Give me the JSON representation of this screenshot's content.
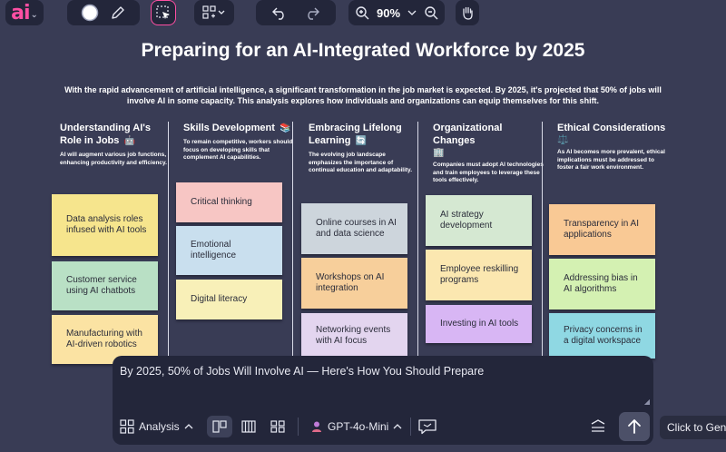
{
  "toolbar": {
    "logo": "ai",
    "zoom": "90%",
    "icons": [
      "color-circle-icon",
      "pencil-icon",
      "select-cursor-icon",
      "layout-grid-icon",
      "undo-icon",
      "redo-icon",
      "zoom-in-icon",
      "zoom-out-icon",
      "hand-icon"
    ]
  },
  "canvas": {
    "title": "Preparing for an AI-Integrated Workforce by 2025",
    "intro": "With the rapid advancement of artificial intelligence, a significant transformation in the job market is expected. By 2025, it's projected that 50% of jobs will involve AI in some capacity. This analysis explores how individuals and organizations can equip themselves for this shift.",
    "columns": [
      {
        "title": "Understanding AI's Role in Jobs",
        "emoji": "🤖",
        "desc": "AI will augment various job functions, enhancing productivity and efficiency.",
        "notes": [
          {
            "text": "Data analysis roles infused with AI tools",
            "color": "#f6e58d"
          },
          {
            "text": "Customer service using AI chatbots",
            "color": "#b9e0c5"
          },
          {
            "text": "Manufacturing with AI-driven robotics",
            "color": "#fbe3a3"
          }
        ]
      },
      {
        "title": "Skills Development",
        "emoji": "📚",
        "desc": "To remain competitive, workers should focus on developing skills that complement AI capabilities.",
        "notes": [
          {
            "text": "Critical thinking",
            "color": "#f7c6c4"
          },
          {
            "text": "Emotional intelligence",
            "color": "#c9dfee"
          },
          {
            "text": "Digital literacy",
            "color": "#f8f0b8"
          }
        ]
      },
      {
        "title": "Embracing Lifelong Learning",
        "emoji": "🔄",
        "desc": "The evolving job landscape emphasizes the importance of continual education and adaptability.",
        "notes": [
          {
            "text": "Online courses in AI and data science",
            "color": "#cdd5dc"
          },
          {
            "text": "Workshops on AI integration",
            "color": "#f7cf9b"
          },
          {
            "text": "Networking events with AI focus",
            "color": "#e3d5ef"
          }
        ]
      },
      {
        "title": "Organizational Changes",
        "emoji": "🏢",
        "desc": "Companies must adopt AI technologies and train employees to leverage these tools effectively.",
        "notes": [
          {
            "text": "AI strategy development",
            "color": "#d5e8d2"
          },
          {
            "text": "Employee reskilling programs",
            "color": "#fbe7b0"
          },
          {
            "text": "Investing in AI tools",
            "color": "#d8b6f4"
          }
        ]
      },
      {
        "title": "Ethical Considerations",
        "emoji": "⚖️",
        "desc": "As AI becomes more prevalent, ethical implications must be addressed to foster a fair work environment.",
        "notes": [
          {
            "text": "Transparency in AI applications",
            "color": "#f9c995"
          },
          {
            "text": "Addressing bias in AI algorithms",
            "color": "#d4f1b2"
          },
          {
            "text": "Privacy concerns in a digital workspace",
            "color": "#8fd8e3"
          }
        ]
      }
    ]
  },
  "prompt": {
    "text": "By 2025, 50% of Jobs Will Involve AI — Here's How You Should Prepare",
    "mode": "Analysis",
    "model": "GPT-4o-Mini",
    "tooltip": "Click to Generate"
  }
}
